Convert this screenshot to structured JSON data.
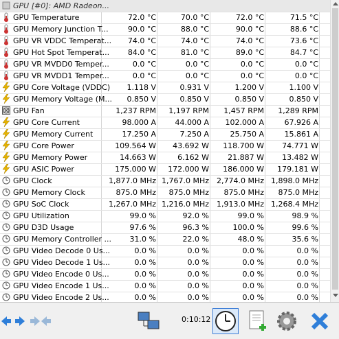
{
  "header": {
    "name": "GPU [#0]: AMD Radeon...",
    "v1": "",
    "v2": "",
    "v3": "",
    "v4": ""
  },
  "rows": [
    {
      "icon": "thermometer-icon",
      "name": "GPU Temperature",
      "v1": "72.0 °C",
      "v2": "70.0 °C",
      "v3": "72.0 °C",
      "v4": "71.5 °C"
    },
    {
      "icon": "thermometer-icon",
      "name": "GPU Memory Junction T...",
      "v1": "90.0 °C",
      "v2": "88.0 °C",
      "v3": "90.0 °C",
      "v4": "88.6 °C"
    },
    {
      "icon": "thermometer-icon",
      "name": "GPU VR VDDC Temperat...",
      "v1": "74.0 °C",
      "v2": "74.0 °C",
      "v3": "74.0 °C",
      "v4": "73.6 °C"
    },
    {
      "icon": "thermometer-icon",
      "name": "GPU Hot Spot Temperat...",
      "v1": "84.0 °C",
      "v2": "81.0 °C",
      "v3": "89.0 °C",
      "v4": "84.7 °C"
    },
    {
      "icon": "thermometer-icon",
      "name": "GPU VR MVDD0 Temper...",
      "v1": "0.0 °C",
      "v2": "0.0 °C",
      "v3": "0.0 °C",
      "v4": "0.0 °C"
    },
    {
      "icon": "thermometer-icon",
      "name": "GPU VR MVDD1 Temper...",
      "v1": "0.0 °C",
      "v2": "0.0 °C",
      "v3": "0.0 °C",
      "v4": "0.0 °C"
    },
    {
      "icon": "lightning-icon",
      "name": "GPU Core Voltage (VDDC)",
      "v1": "1.118 V",
      "v2": "0.931 V",
      "v3": "1.200 V",
      "v4": "1.100 V"
    },
    {
      "icon": "lightning-icon",
      "name": "GPU Memory Voltage (M...",
      "v1": "0.850 V",
      "v2": "0.850 V",
      "v3": "0.850 V",
      "v4": "0.850 V"
    },
    {
      "icon": "fan-icon",
      "name": "GPU Fan",
      "v1": "1,237 RPM",
      "v2": "1,197 RPM",
      "v3": "1,457 RPM",
      "v4": "1,289 RPM"
    },
    {
      "icon": "lightning-icon",
      "name": "GPU Core Current",
      "v1": "98.000 A",
      "v2": "44.000 A",
      "v3": "102.000 A",
      "v4": "67.926 A"
    },
    {
      "icon": "lightning-icon",
      "name": "GPU Memory Current",
      "v1": "17.250 A",
      "v2": "7.250 A",
      "v3": "25.750 A",
      "v4": "15.861 A"
    },
    {
      "icon": "lightning-icon",
      "name": "GPU Core Power",
      "v1": "109.564 W",
      "v2": "43.692 W",
      "v3": "118.700 W",
      "v4": "74.771 W"
    },
    {
      "icon": "lightning-icon",
      "name": "GPU Memory Power",
      "v1": "14.663 W",
      "v2": "6.162 W",
      "v3": "21.887 W",
      "v4": "13.482 W"
    },
    {
      "icon": "lightning-icon",
      "name": "GPU ASIC Power",
      "v1": "175.000 W",
      "v2": "172.000 W",
      "v3": "186.000 W",
      "v4": "179.181 W"
    },
    {
      "icon": "clock-icon",
      "name": "GPU Clock",
      "v1": "1,877.0 MHz",
      "v2": "1,767.0 MHz",
      "v3": "2,774.0 MHz",
      "v4": "1,898.0 MHz"
    },
    {
      "icon": "clock-icon",
      "name": "GPU Memory Clock",
      "v1": "875.0 MHz",
      "v2": "875.0 MHz",
      "v3": "875.0 MHz",
      "v4": "875.0 MHz"
    },
    {
      "icon": "clock-icon",
      "name": "GPU SoC Clock",
      "v1": "1,267.0 MHz",
      "v2": "1,216.0 MHz",
      "v3": "1,913.0 MHz",
      "v4": "1,268.4 MHz"
    },
    {
      "icon": "clock-icon",
      "name": "GPU Utilization",
      "v1": "99.0 %",
      "v2": "92.0 %",
      "v3": "99.0 %",
      "v4": "98.9 %"
    },
    {
      "icon": "clock-icon",
      "name": "GPU D3D Usage",
      "v1": "97.6 %",
      "v2": "96.3 %",
      "v3": "100.0 %",
      "v4": "99.6 %"
    },
    {
      "icon": "clock-icon",
      "name": "GPU Memory Controller ...",
      "v1": "31.0 %",
      "v2": "22.0 %",
      "v3": "48.0 %",
      "v4": "35.6 %"
    },
    {
      "icon": "clock-icon",
      "name": "GPU Video Decode 0 Us...",
      "v1": "0.0 %",
      "v2": "0.0 %",
      "v3": "0.0 %",
      "v4": "0.0 %"
    },
    {
      "icon": "clock-icon",
      "name": "GPU Video Decode 1 Us...",
      "v1": "0.0 %",
      "v2": "0.0 %",
      "v3": "0.0 %",
      "v4": "0.0 %"
    },
    {
      "icon": "clock-icon",
      "name": "GPU Video Encode 0 Us...",
      "v1": "0.0 %",
      "v2": "0.0 %",
      "v3": "0.0 %",
      "v4": "0.0 %"
    },
    {
      "icon": "clock-icon",
      "name": "GPU Video Encode 1 Us...",
      "v1": "0.0 %",
      "v2": "0.0 %",
      "v3": "0.0 %",
      "v4": "0.0 %"
    },
    {
      "icon": "clock-icon",
      "name": "GPU Video Encode 2 Us...",
      "v1": "0.0 %",
      "v2": "0.0 %",
      "v3": "0.0 %",
      "v4": "0.0 %"
    }
  ],
  "toolbar": {
    "timer": "0:10:12",
    "buttons": [
      "navigate-arrows-icon",
      "navigate-arrows-alt-icon",
      "network-computers-icon",
      "clock-icon",
      "add-report-icon",
      "gear-icon",
      "close-x-icon"
    ]
  },
  "colors": {
    "thermometer": "#c33",
    "lightning": "#e8b400",
    "clock": "#555",
    "fan": "#555",
    "close": "#2f7fd9"
  }
}
